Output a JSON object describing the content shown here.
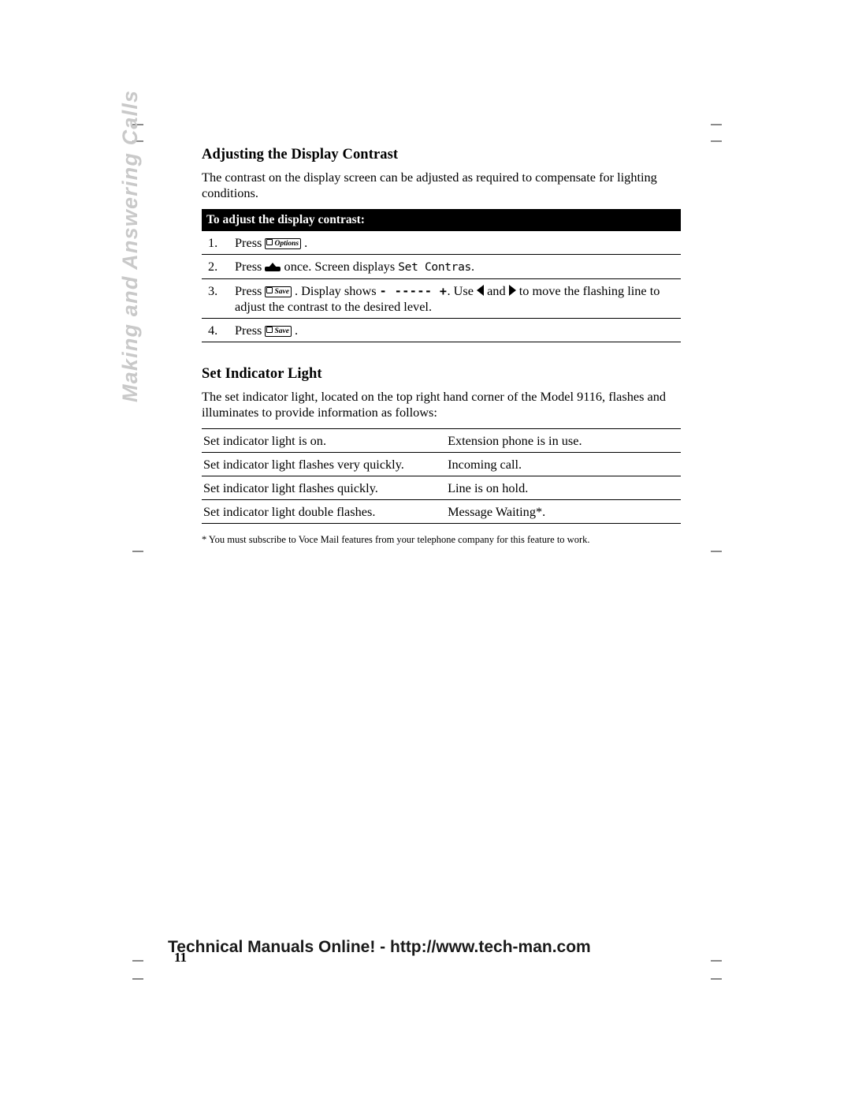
{
  "sidebar": {
    "tab_label": "Making and Answering Calls"
  },
  "sections": [
    {
      "title": "Adjusting the Display Contrast",
      "intro": "The contrast on the display screen can be adjusted as required to compensate for lighting conditions.",
      "bar_label": "To adjust the display contrast:",
      "steps": [
        {
          "num": "1.",
          "press": "Press",
          "key": "Options",
          "after": "."
        },
        {
          "num": "2.",
          "press": "Press",
          "key": "up-arrow-icon",
          "after": "once. Screen displays",
          "screen_text": "Set Contras",
          "tail": "."
        },
        {
          "num": "3.",
          "press": "Press",
          "key": "Save",
          "after": ". Display shows",
          "display_glyph": "- ----- +",
          "after2": ". Use",
          "left_icon": "left-triangle-icon",
          "and": "and",
          "right_icon": "right-triangle-icon",
          "after3": "to move the flashing line to adjust the contrast to the desired level."
        },
        {
          "num": "4.",
          "press": "Press",
          "key": "Save",
          "after": "."
        }
      ]
    },
    {
      "title": "Set Indicator Light",
      "intro": "The set indicator light, located on the top right hand corner of the Model 9116, flashes and illuminates to provide information as follows:",
      "table": {
        "rows": [
          {
            "condition": "Set indicator light is on.",
            "meaning": "Extension phone is in use."
          },
          {
            "condition": "Set indicator light flashes very quickly.",
            "meaning": "Incoming call."
          },
          {
            "condition": "Set indicator light flashes quickly.",
            "meaning": "Line is on hold."
          },
          {
            "condition": "Set indicator light double flashes.",
            "meaning": "Message Waiting*."
          }
        ]
      },
      "footnote": "* You must subscribe to Voce Mail features from your telephone company for this feature to work."
    }
  ],
  "footer": {
    "banner": "Technical Manuals Online! - http://www.tech-man.com",
    "page_number": "11"
  }
}
